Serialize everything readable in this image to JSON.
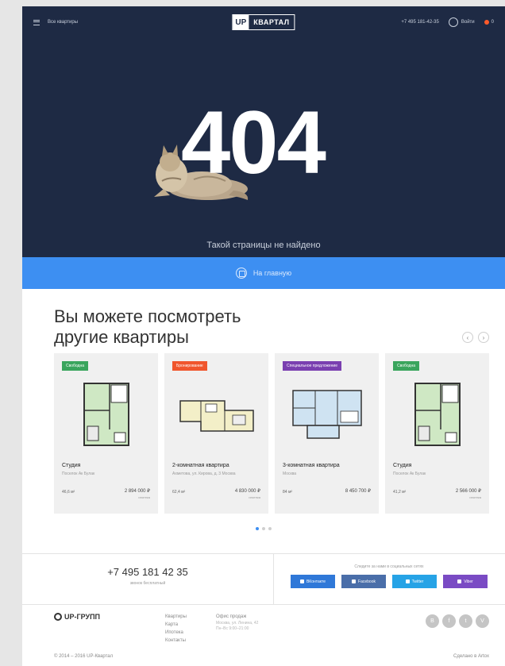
{
  "header": {
    "menu_label": "Все квартиры",
    "logo_mark": "UP",
    "logo_text": "КВАРТАЛ",
    "phone": "+7 495 181-42-35",
    "login_label": "Войти",
    "favorites_count": "0"
  },
  "hero": {
    "code": "404",
    "message": "Такой страницы не найдено"
  },
  "home_bar": {
    "label": "На главную"
  },
  "section": {
    "title_line1": "Вы можете посмотреть",
    "title_line2": "другие квартиры",
    "prev_arrow": "‹",
    "next_arrow": "›"
  },
  "cards": [
    {
      "badge": "Свободна",
      "badge_color": "#3aa55d",
      "name": "Студия",
      "address": "Поселок Ак Булак",
      "area": "46,6 м²",
      "price": "2 894 000 ₽",
      "price_note": "ипотека"
    },
    {
      "badge": "Бронирование",
      "badge_color": "#f0562d",
      "name": "2-комнатная квартира",
      "address": "Ахметова, ул. Кирова, д. 3 Москва",
      "area": "62,4 м²",
      "price": "4 830 000 ₽",
      "price_note": "ипотека"
    },
    {
      "badge": "Специальное предложение",
      "badge_color": "#7a3fb0",
      "name": "3-комнатная квартира",
      "address": "Москва",
      "area": "84 м²",
      "price": "8 450 700 ₽",
      "price_note": ""
    },
    {
      "badge": "Свободна",
      "badge_color": "#3aa55d",
      "name": "Студия",
      "address": "Поселок Ак Булак",
      "area": "41,2 м²",
      "price": "2 566 000 ₽",
      "price_note": "ипотека"
    }
  ],
  "contacts": {
    "phone": "+7 495 181 42 35",
    "phone_note": "звонок бесплатный",
    "social_caption": "Следите за нами в социальных сетях",
    "social": [
      {
        "label": "ВКонтакте",
        "color": "#2f78d8"
      },
      {
        "label": "Facebook",
        "color": "#4a6ea9"
      },
      {
        "label": "Twitter",
        "color": "#26a3e6"
      },
      {
        "label": "Viber",
        "color": "#7a4bc4"
      }
    ]
  },
  "footer": {
    "logo_text": "UP-ГРУПП",
    "col1": [
      "Квартиры",
      "Карта",
      "Ипотека",
      "Контакты"
    ],
    "col2_title": "Офис продаж",
    "col2_lines": [
      "Москва, ул. Ленина, 42",
      "Пн–Вс 9:00–21:00"
    ],
    "icons": [
      "vk-icon",
      "facebook-icon",
      "twitter-icon",
      "viber-icon"
    ],
    "icon_glyphs": [
      "В",
      "f",
      "t",
      "V"
    ],
    "copyright": "© 2014 – 2016 UP-Квартал",
    "developer": "Сделано в Artox"
  }
}
